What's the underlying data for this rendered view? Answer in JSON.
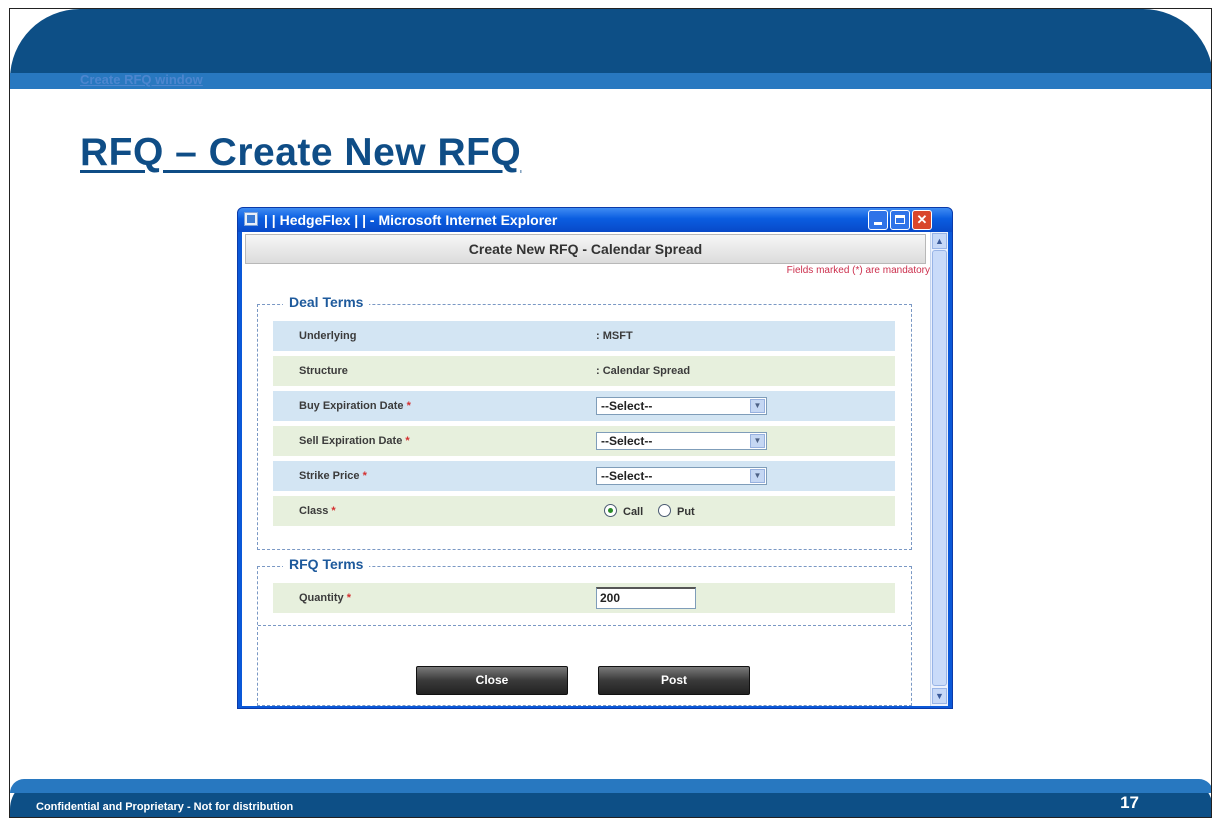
{
  "slide": {
    "breadcrumb": "Create RFQ window",
    "title": "RFQ – Create New RFQ",
    "footer": "Confidential and Proprietary  - Not for distribution",
    "page_number": "17"
  },
  "window": {
    "title": "| | HedgeFlex | | - Microsoft Internet Explorer",
    "controls": {
      "minimize_icon": "minimize-icon",
      "maximize_icon": "maximize-icon",
      "close_icon": "close-icon"
    }
  },
  "form": {
    "header": "Create New RFQ - Calendar Spread",
    "mandatory_note": "Fields marked (*) are mandatory",
    "deal_terms": {
      "legend": "Deal Terms",
      "underlying_label": "Underlying",
      "underlying_value": ": MSFT",
      "structure_label": "Structure",
      "structure_value": ": Calendar Spread",
      "buy_exp_label": "Buy Expiration Date",
      "buy_exp_value": "--Select--",
      "sell_exp_label": "Sell Expiration Date",
      "sell_exp_value": "--Select--",
      "strike_label": "Strike Price",
      "strike_value": "--Select--",
      "class_label": "Class",
      "class_options": [
        "Call",
        "Put"
      ],
      "class_selected": "Call",
      "required_marker": "*"
    },
    "rfq_terms": {
      "legend": "RFQ Terms",
      "quantity_label": "Quantity",
      "quantity_value": "200"
    },
    "buttons": {
      "close": "Close",
      "post": "Post"
    }
  },
  "colors": {
    "band": "#0d4f86",
    "title": "#0f4d86",
    "row_blue": "#d3e5f3",
    "row_green": "#e7f0dd",
    "required": "#d43030"
  }
}
